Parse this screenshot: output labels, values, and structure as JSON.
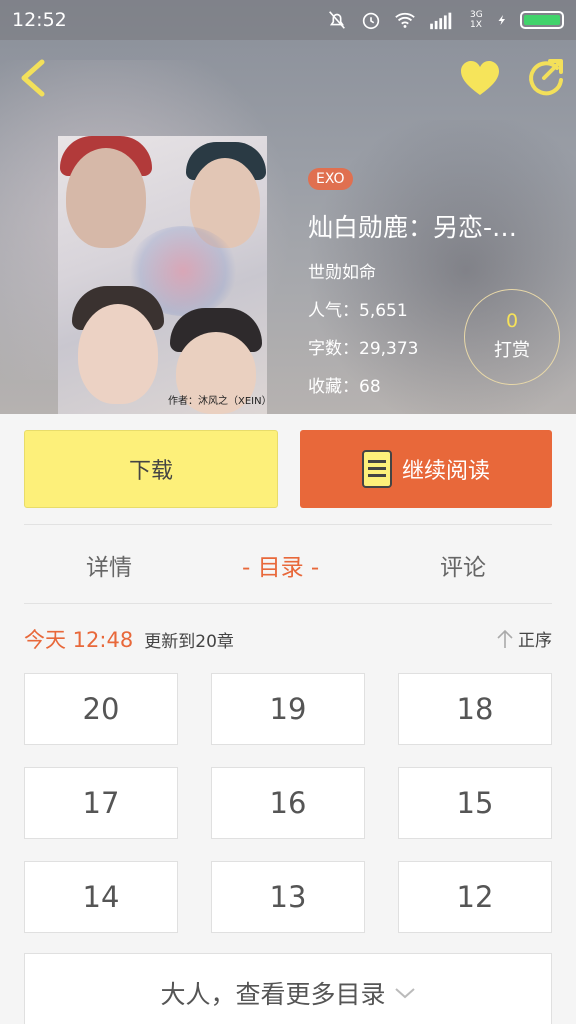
{
  "status_bar": {
    "time": "12:52",
    "network": "3G 1X"
  },
  "book": {
    "tag": "EXO",
    "title": "灿白勋鹿：另恋-…",
    "author": "世勋如命",
    "popularity": "人气：5,651",
    "word_count": "字数：29,373",
    "favorites": "收藏：68",
    "cover_text": "作者：沐风之（XEIN）"
  },
  "tip": {
    "count": "0",
    "label": "打赏"
  },
  "actions": {
    "download": "下载",
    "continue_read": "继续阅读"
  },
  "tabs": [
    {
      "label": "详情"
    },
    {
      "label": "- 目录 -"
    },
    {
      "label": "评论"
    }
  ],
  "update": {
    "today": "今天 12:48",
    "text": "更新到20章",
    "sort": "正序"
  },
  "chapters": [
    "20",
    "19",
    "18",
    "17",
    "16",
    "15",
    "14",
    "13",
    "12"
  ],
  "more": {
    "label": "大人，查看更多目录"
  },
  "colors": {
    "accent": "#e8683a",
    "yellow": "#fdf07a"
  }
}
